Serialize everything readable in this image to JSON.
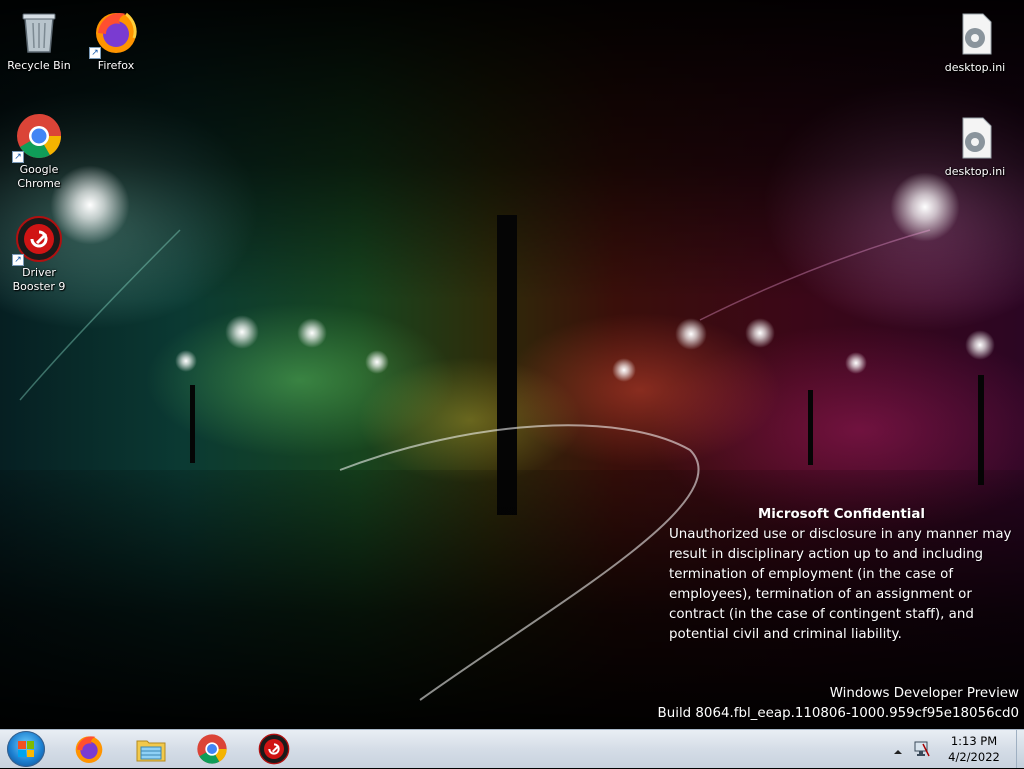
{
  "desktop": {
    "icons": [
      {
        "label": "Recycle Bin"
      },
      {
        "label": "Firefox"
      },
      {
        "label": "Google Chrome"
      },
      {
        "label": "Driver Booster 9"
      },
      {
        "label": "desktop.ini"
      },
      {
        "label": "desktop.ini"
      }
    ]
  },
  "watermark": {
    "title": "Microsoft Confidential",
    "body": "Unauthorized use or disclosure in any manner may result in disciplinary action up to and including termination of employment (in the case of employees), termination of an assignment or contract (in the case of contingent staff), and potential civil and criminal liability.",
    "edition": "Windows Developer Preview",
    "build": "Build 8064.fbl_eeap.110806-1000.959cf95e18056cd0"
  },
  "taskbar": {
    "pinned": [
      {
        "icon": "firefox-icon"
      },
      {
        "icon": "file-explorer-icon"
      },
      {
        "icon": "chrome-icon"
      },
      {
        "icon": "driver-booster-icon"
      }
    ],
    "clock": {
      "time": "1:13 PM",
      "date": "4/2/2022"
    }
  },
  "colors": {
    "taskbar": "#d5dde7",
    "start_orb": "#1c7fd0"
  }
}
